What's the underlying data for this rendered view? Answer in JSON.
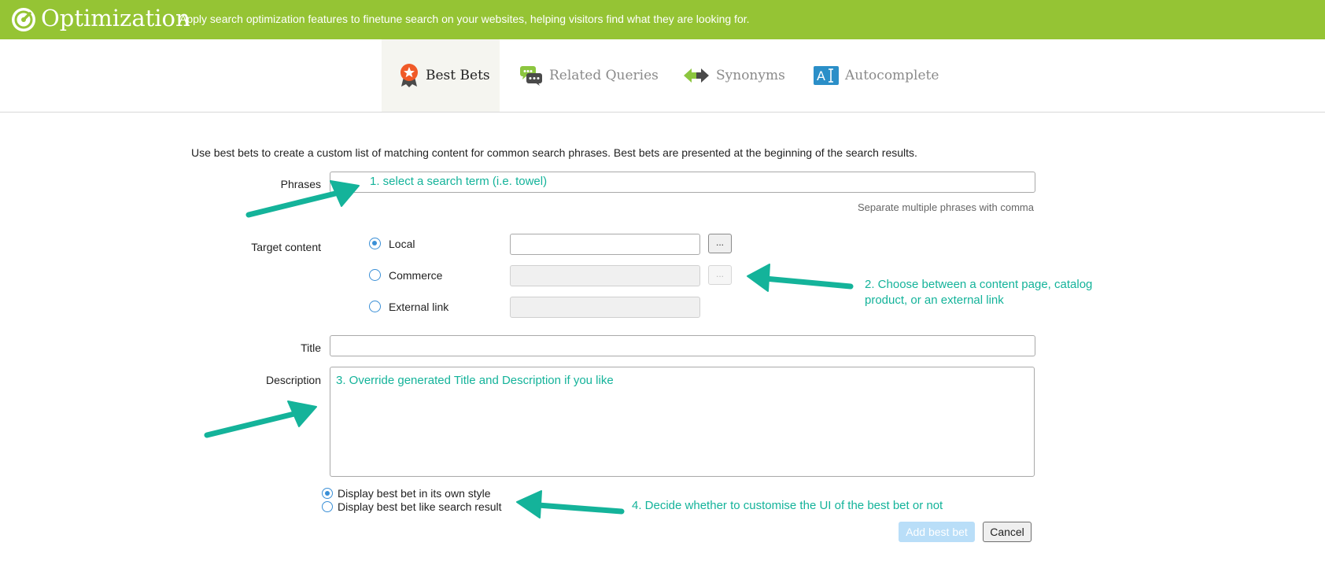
{
  "header": {
    "title": "Optimization",
    "subtitle": "Apply search optimization features to finetune search on your websites, helping visitors find what they are looking for.",
    "brand_color": "#95c434"
  },
  "tabs": [
    {
      "label": "Best Bets",
      "icon": "rosette-icon",
      "active": true
    },
    {
      "label": "Related Queries",
      "icon": "chat-bubbles-icon",
      "active": false
    },
    {
      "label": "Synonyms",
      "icon": "double-arrow-icon",
      "active": false
    },
    {
      "label": "Autocomplete",
      "icon": "text-cursor-icon",
      "active": false
    }
  ],
  "form": {
    "intro": "Use best bets to create a custom list of matching content for common search phrases. Best bets are presented at the beginning of the search results.",
    "phrases": {
      "label": "Phrases",
      "value": "",
      "hint": "Separate multiple phrases with comma"
    },
    "target_content": {
      "label": "Target content",
      "browse_label": "...",
      "options": [
        {
          "label": "Local",
          "selected": true,
          "value": ""
        },
        {
          "label": "Commerce",
          "selected": false,
          "value": ""
        },
        {
          "label": "External link",
          "selected": false,
          "value": ""
        }
      ]
    },
    "title": {
      "label": "Title",
      "value": ""
    },
    "description": {
      "label": "Description",
      "value": ""
    },
    "display_options": [
      {
        "label": "Display best bet in its own style",
        "selected": true
      },
      {
        "label": "Display best bet like search result",
        "selected": false
      }
    ],
    "add_button": "Add best bet",
    "cancel_button": "Cancel"
  },
  "annotations": {
    "step1": "1. select a search term (i.e. towel)",
    "step2_line1": "2. Choose between a content page, catalog",
    "step2_line2": "product, or an external link",
    "step3": "3. Override generated Title and Description if you like",
    "step4": "4. Decide whether to customise the UI of the best bet or not",
    "color": "#14b39a"
  }
}
